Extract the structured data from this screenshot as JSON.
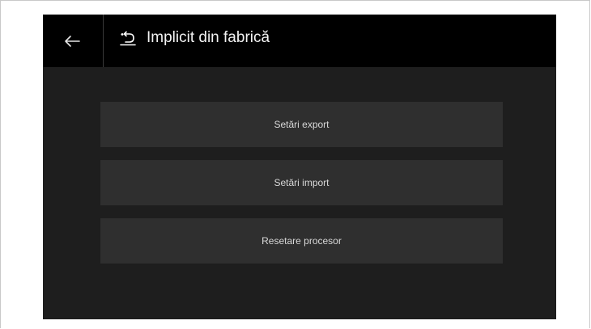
{
  "header": {
    "back_icon": "arrow-left-icon",
    "title_icon": "reset-icon",
    "title": "Implicit din fabrică"
  },
  "actions": [
    {
      "label": "Setări export"
    },
    {
      "label": "Setări import"
    },
    {
      "label": "Resetare procesor"
    }
  ],
  "colors": {
    "header_bg": "#000000",
    "panel_bg": "#1e1e1e",
    "button_bg": "#2f2f2f",
    "text": "#d8d8d8"
  }
}
